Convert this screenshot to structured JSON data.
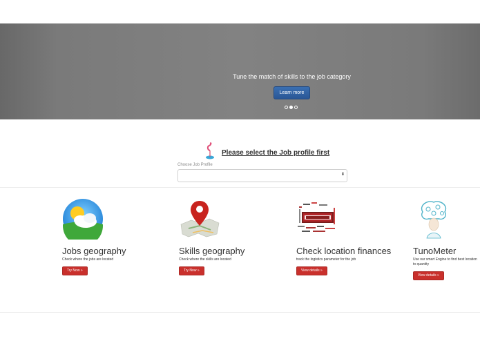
{
  "hero": {
    "caption": "Tune the match of skills to the job category",
    "button_label": "Learn more",
    "slide_count": 3,
    "active_slide": 2
  },
  "job_select": {
    "title": "Please select the Job profile first",
    "label": "Choose Job Profile",
    "selected_value": "",
    "arrow": "⬍"
  },
  "features": [
    {
      "title": "Jobs geography",
      "description": "Check where the jobs are located",
      "button_label": "Try Now »",
      "icon": "sun-cloud-icon"
    },
    {
      "title": "Skills geography",
      "description": "Check where the skills are located",
      "button_label": "Try Now »",
      "icon": "map-pin-icon"
    },
    {
      "title": "Check location finances",
      "description": "track the logistics parameter for the job",
      "button_label": "View details »",
      "icon": "keywords-cloud-icon"
    },
    {
      "title": "TunoMeter",
      "description": "Use our smart Engine to find best location to quantity",
      "button_label": "View details »",
      "icon": "head-tree-icon"
    }
  ],
  "colors": {
    "hero_bg": "#7f7f7f",
    "primary_button": "#2f62a6",
    "danger_button": "#c9302c"
  }
}
